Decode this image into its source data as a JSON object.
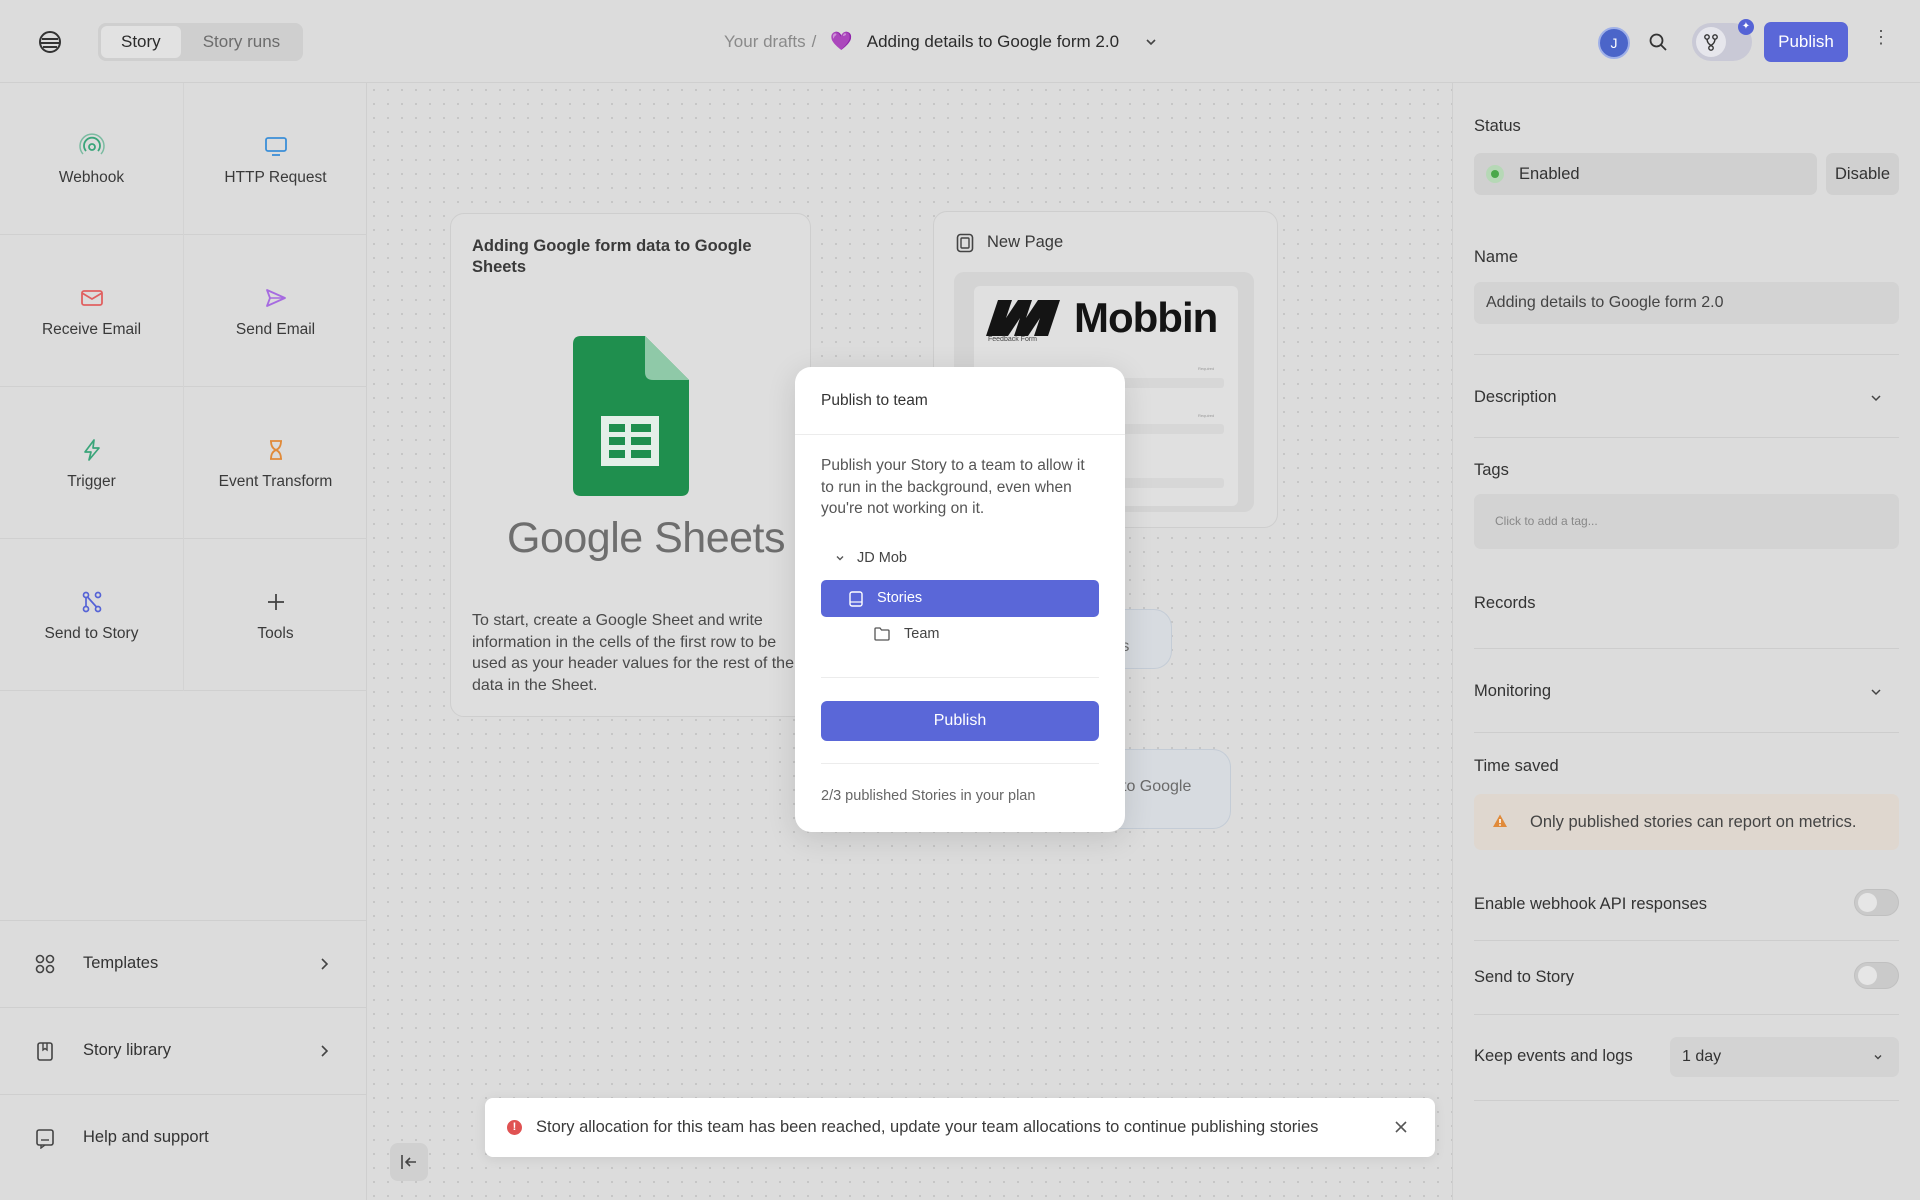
{
  "header": {
    "tabs": [
      "Story",
      "Story runs"
    ],
    "breadcrumb_parent": "Your drafts",
    "breadcrumb_separator": "/",
    "story_title": "Adding details to Google form 2.0",
    "avatar_initial": "J",
    "publish_label": "Publish"
  },
  "tools": [
    {
      "label": "Webhook",
      "icon": "webhook-icon"
    },
    {
      "label": "HTTP Request",
      "icon": "monitor-icon"
    },
    {
      "label": "Receive Email",
      "icon": "envelope-icon"
    },
    {
      "label": "Send Email",
      "icon": "send-icon"
    },
    {
      "label": "Trigger",
      "icon": "lightning-icon"
    },
    {
      "label": "Event Transform",
      "icon": "hourglass-icon"
    },
    {
      "label": "Send to Story",
      "icon": "branch-icon"
    },
    {
      "label": "Tools",
      "icon": "plus-icon"
    }
  ],
  "sidebar_bottom": {
    "templates": "Templates",
    "story_library": "Story library",
    "help": "Help and support"
  },
  "canvas": {
    "card1_title": "Adding Google form data to Google Sheets",
    "card1_logo_text": "Google Sheets",
    "card1_body": "To start, create a Google Sheet and write information in the cells of the first row to be used as your header values for the rest of the data in the Sheet.",
    "card2_title": "New Page",
    "card2_brand": "Mobbin",
    "card2_form_label": "Feedback Form",
    "card2_required": "Required",
    "ghost1_text": "ets",
    "ghost2_text": "to Google"
  },
  "modal": {
    "title": "Publish to team",
    "description": "Publish your Story to a team to allow it to run in the background, even when you're not working on it.",
    "tree": {
      "root": "JD Mob",
      "selected": "Stories",
      "child": "Team"
    },
    "publish_label": "Publish",
    "plan_text": "2/3 published Stories in your plan"
  },
  "toast": {
    "message": "Story allocation for this team has been reached, update your team allocations to continue publishing stories",
    "icon": "!"
  },
  "right_panel": {
    "status_label": "Status",
    "status_value": "Enabled",
    "disable_label": "Disable",
    "name_label": "Name",
    "name_value": "Adding details to Google form 2.0",
    "description_label": "Description",
    "tags_label": "Tags",
    "tags_placeholder": "Click to add a tag...",
    "records_label": "Records",
    "monitoring_label": "Monitoring",
    "time_saved_label": "Time saved",
    "metrics_warning": "Only published stories can report on metrics.",
    "webhook_api_label": "Enable webhook API responses",
    "send_to_story_label": "Send to Story",
    "keep_events_label": "Keep events and logs",
    "keep_events_value": "1 day"
  },
  "colors": {
    "accent": "#5a67d8",
    "background": "#dcdcdc",
    "error": "#e05252",
    "sheets_green": "#1f8f4e"
  }
}
